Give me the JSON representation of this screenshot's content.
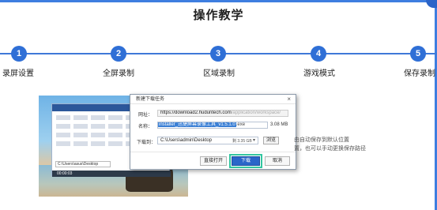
{
  "page_title": "操作教学",
  "colors": {
    "accent": "#2f6fd6",
    "line": "#3f79d8",
    "highlight": "#33c6a0"
  },
  "steps": [
    {
      "number": "1",
      "label": "录屏设置"
    },
    {
      "number": "2",
      "label": "全屏录制"
    },
    {
      "number": "3",
      "label": "区域录制"
    },
    {
      "number": "4",
      "label": "游戏模式"
    },
    {
      "number": "5",
      "label": "保存录制"
    }
  ],
  "screenshot": {
    "app_path": "C:\\Users\\asus\\Desktop",
    "timer": "00:00:03"
  },
  "dialog": {
    "title": "新建下载任务",
    "close_icon": "close-icon",
    "url_label": "网址：",
    "url_value": "https://download2.hudunt.com/application/workspace/",
    "url_host": "https://download2.huduntech.com",
    "url_path": "/application/workspace/",
    "name_label": "名称：",
    "name_selected": "installer_迅捷屏幕录像工具_v1.5.1.0",
    "name_ext": ".exe",
    "file_size": "3.08 MB",
    "path_label": "下载到：",
    "path_value": "C:\\Users\\admin\\Desktop",
    "disk_free": "剩 3.35 GB",
    "browse_button": "浏览",
    "open_button": "直接打开",
    "download_button": "下载",
    "cancel_button": "取消"
  },
  "description": {
    "line1": "由自动保存到默认位置",
    "line2": "置，也可以手动更换保存路径"
  }
}
